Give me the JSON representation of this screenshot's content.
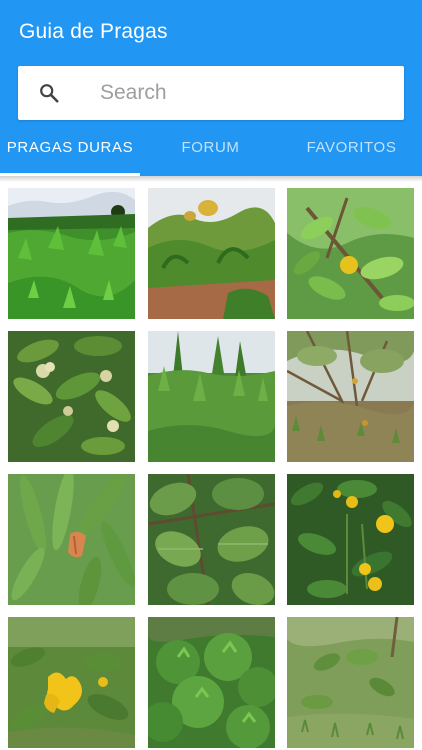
{
  "app": {
    "title": "Guia de Pragas"
  },
  "search": {
    "placeholder": "Search",
    "icon": "search-icon"
  },
  "tabs": [
    {
      "label": "PRAGAS DURAS",
      "active": true
    },
    {
      "label": "FORUM",
      "active": false
    },
    {
      "label": "FAVORITOS",
      "active": false
    }
  ],
  "colors": {
    "primary": "#2196f3",
    "indicator": "#ffffff"
  },
  "gallery": [
    {
      "name": "plant-photo-1",
      "scene": "dense green shrubs under cloudy sky"
    },
    {
      "name": "plant-photo-2",
      "scene": "leafy shrubs with yellow flowers on red soil"
    },
    {
      "name": "plant-photo-3",
      "scene": "branch with yellow fruit and broad leaves"
    },
    {
      "name": "plant-photo-4",
      "scene": "leaves with pale flower clusters"
    },
    {
      "name": "plant-photo-5",
      "scene": "tall green stalks with pale sky"
    },
    {
      "name": "plant-photo-6",
      "scene": "thin tree branches over dry grass"
    },
    {
      "name": "plant-photo-7",
      "scene": "long leaves with orange flower"
    },
    {
      "name": "plant-photo-8",
      "scene": "close-up broad green leaves"
    },
    {
      "name": "plant-photo-9",
      "scene": "dark foliage with yellow flowers"
    },
    {
      "name": "plant-photo-10",
      "scene": "shrub with bright yellow flowers"
    },
    {
      "name": "plant-photo-11",
      "scene": "dense low green shrubs"
    },
    {
      "name": "plant-photo-12",
      "scene": "sparse small plants on grass"
    }
  ]
}
